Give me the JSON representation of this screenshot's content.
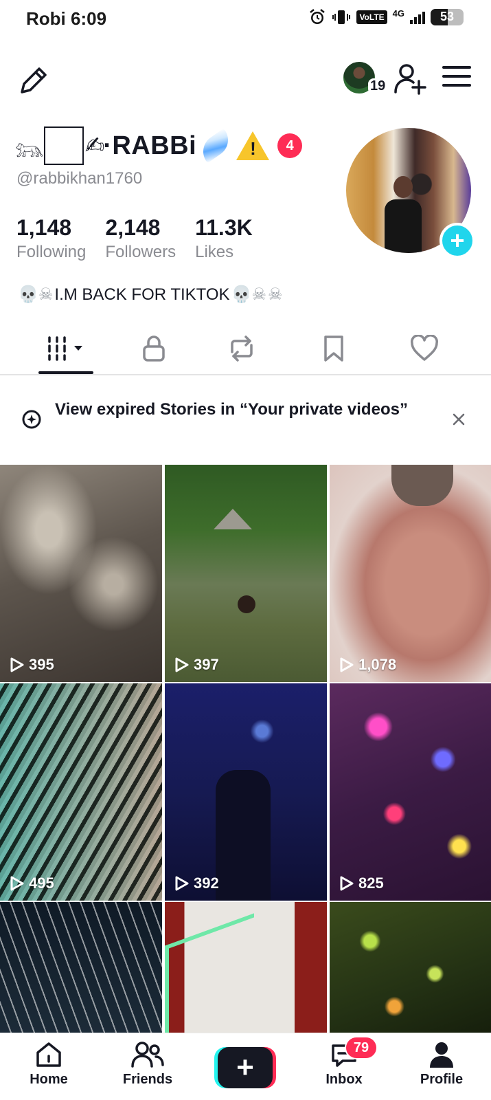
{
  "status_bar": {
    "carrier_time": "Robi 6:09",
    "volte": "VoLTE",
    "network": "4G",
    "battery": "53",
    "battery_level": 0.53,
    "icons": [
      "alarm-icon",
      "vibrate-icon",
      "signal-icon",
      "battery-icon"
    ]
  },
  "top_bar": {
    "friend_avatar_count": "19",
    "icons": [
      "edit-pencil-icon",
      "add-friend-icon",
      "hamburger-menu-icon"
    ]
  },
  "profile": {
    "display_name": "·RABBi",
    "warning_emoji": "⚠",
    "notification_count": "4",
    "username": "@rabbikhan1760",
    "stats": [
      {
        "value": "1,148",
        "label": "Following"
      },
      {
        "value": "2,148",
        "label": "Followers"
      },
      {
        "value": "11.3K",
        "label": "Likes"
      }
    ],
    "bio": "I.M BACK FOR TIKTOK",
    "bio_decor": "💀☠"
  },
  "tabs": {
    "icons": [
      "videos-grid-icon",
      "lock-icon",
      "repost-icon",
      "bookmark-icon",
      "heart-icon"
    ],
    "active": 0
  },
  "stories_banner": {
    "text": "View expired Stories in “Your private videos”"
  },
  "videos": [
    {
      "views": "395"
    },
    {
      "views": "397"
    },
    {
      "views": "1,078"
    },
    {
      "views": "495"
    },
    {
      "views": "392"
    },
    {
      "views": "825"
    },
    {
      "views": ""
    },
    {
      "views": ""
    },
    {
      "views": ""
    }
  ],
  "bottom_nav": {
    "home": "Home",
    "friends": "Friends",
    "inbox": "Inbox",
    "inbox_badge": "79",
    "profile": "Profile"
  },
  "colors": {
    "accent_red": "#fe2c55",
    "accent_cyan": "#20d5ec",
    "text_primary": "#161823",
    "text_secondary": "#8a8b91"
  }
}
